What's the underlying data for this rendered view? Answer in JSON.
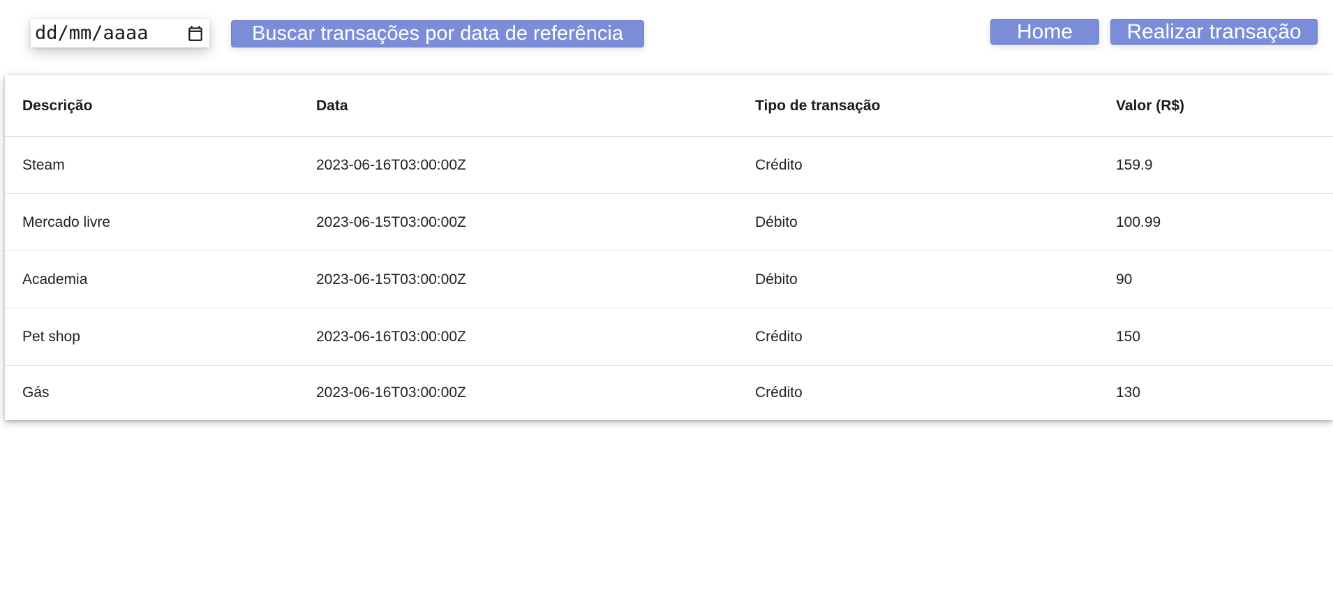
{
  "date_input": {
    "value": "dd/mm/aaaa",
    "icon": "calendar-icon"
  },
  "toolbar": {
    "search_label": "Buscar transações por data de referência",
    "home_label": "Home",
    "new_transaction_label": "Realizar transação"
  },
  "colors": {
    "button_bg": "#7b8cd9",
    "button_text": "#ffffff",
    "row_divider": "#e0e0e0"
  },
  "table": {
    "headers": [
      "Descrição",
      "Data",
      "Tipo de transação",
      "Valor (R$)"
    ],
    "rows": [
      [
        "Steam",
        "2023-06-16T03:00:00Z",
        "Crédito",
        "159.9"
      ],
      [
        "Mercado livre",
        "2023-06-15T03:00:00Z",
        "Débito",
        "100.99"
      ],
      [
        "Academia",
        "2023-06-15T03:00:00Z",
        "Débito",
        "90"
      ],
      [
        "Pet shop",
        "2023-06-16T03:00:00Z",
        "Crédito",
        "150"
      ],
      [
        "Gás",
        "2023-06-16T03:00:00Z",
        "Crédito",
        "130"
      ]
    ]
  }
}
